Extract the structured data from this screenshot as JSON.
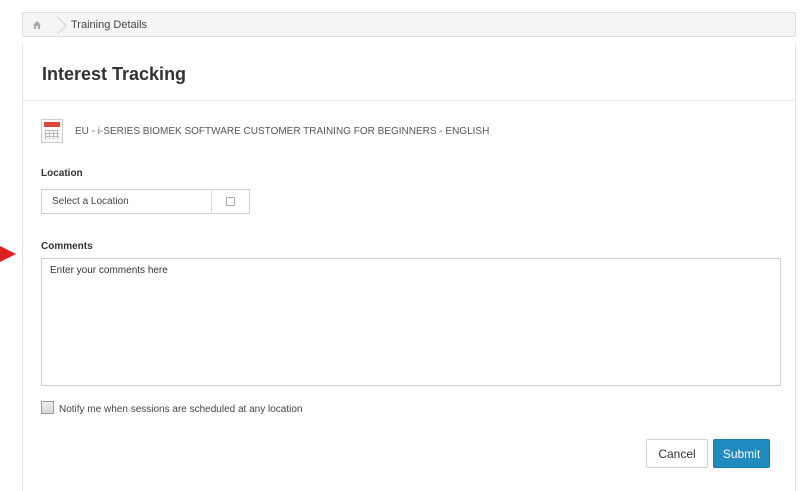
{
  "breadcrumb": {
    "home_icon": "home-icon",
    "current": "Training Details"
  },
  "panel": {
    "title": "Interest Tracking"
  },
  "training": {
    "icon": "calendar-icon",
    "title": "EU - i-SERIES BIOMEK SOFTWARE CUSTOMER TRAINING FOR BEGINNERS - ENGLISH"
  },
  "location": {
    "label": "Location",
    "value": "Select a Location",
    "picker_icon": "picker-icon"
  },
  "comments": {
    "label": "Comments",
    "value": "Enter your comments here"
  },
  "notify": {
    "label": "Notify me when sessions are scheduled at any location",
    "checked": false
  },
  "actions": {
    "cancel_label": "Cancel",
    "submit_label": "Submit"
  },
  "colors": {
    "submit_bg": "#1f8bbf",
    "arrow": "#e02020",
    "calendar_accent": "#d94a3d"
  }
}
